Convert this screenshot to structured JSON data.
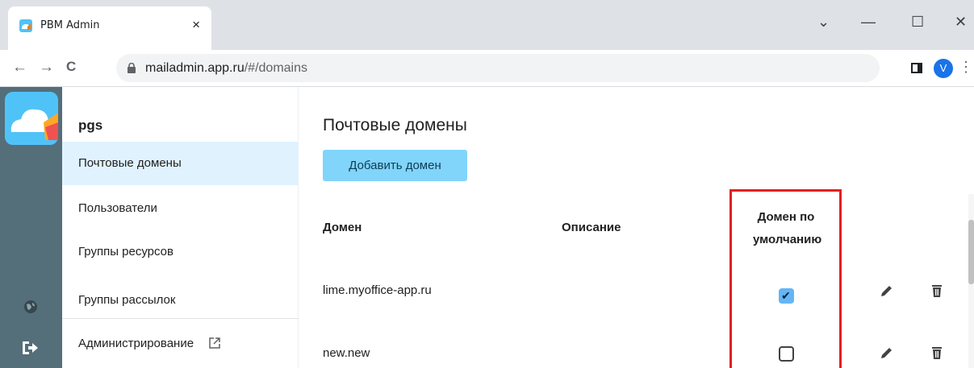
{
  "browser": {
    "tab_title": "PBM Admin",
    "tab_close": "×",
    "tab_search": "⌄",
    "minimize": "—",
    "maximize": "☐",
    "close": "✕",
    "url_host": "mailadmin.app.ru",
    "url_path": "/#/domains",
    "avatar_letter": "V",
    "menu": "⋮",
    "back": "←",
    "forward": "→",
    "reload": "C"
  },
  "sidebar": {
    "org": "pgs",
    "items": [
      {
        "label": "Почтовые домены",
        "active": true
      },
      {
        "label": "Пользователи"
      },
      {
        "label": "Группы ресурсов"
      },
      {
        "label": "Группы рассылок"
      },
      {
        "label": "Администрирование"
      }
    ]
  },
  "main": {
    "title": "Почтовые домены",
    "add_button": "Добавить домен",
    "columns": {
      "domain": "Домен",
      "description": "Описание",
      "default_line1": "Домен по",
      "default_line2": "умолчанию"
    },
    "rows": [
      {
        "domain": "lime.myoffice-app.ru",
        "description": "",
        "is_default": true
      },
      {
        "domain": "new.new",
        "description": "",
        "is_default": false
      }
    ]
  },
  "colors": {
    "accent": "#81d4fa",
    "active_item": "#e0f2fe",
    "rail": "#546e7a",
    "highlight": "#e02020"
  },
  "icons": [
    "search-icon",
    "lock-icon",
    "edit-icon",
    "delete-icon",
    "globe-icon",
    "logout-icon",
    "external-link-icon"
  ]
}
